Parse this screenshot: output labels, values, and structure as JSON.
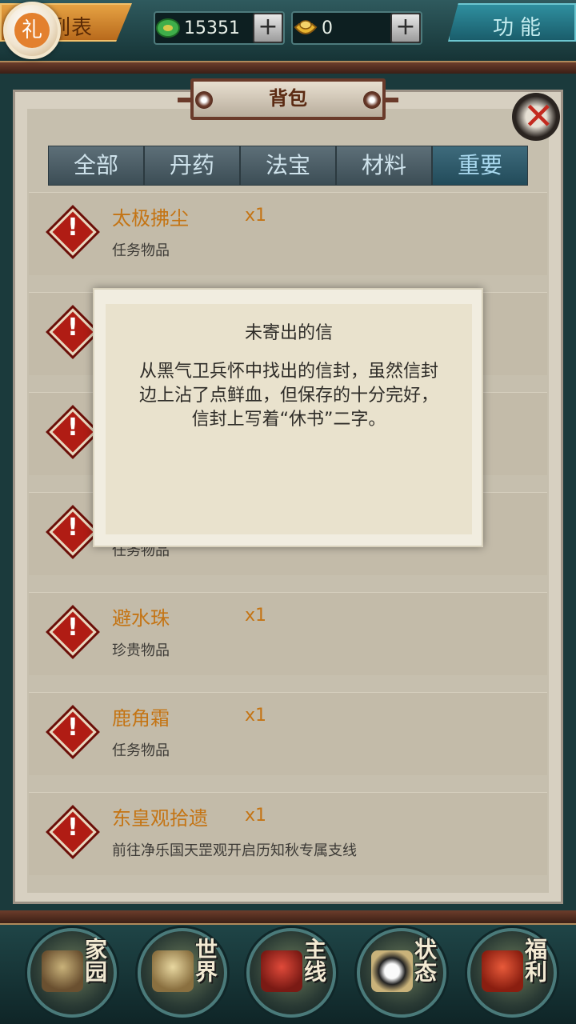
{
  "header": {
    "list_label": "列表",
    "gift_label": "礼",
    "jade_value": "15351",
    "gold_value": "0",
    "plus_label": "+",
    "function_label": "功能"
  },
  "panel": {
    "title": "背包",
    "close_label": "✕"
  },
  "tabs": [
    {
      "label": "全部"
    },
    {
      "label": "丹药"
    },
    {
      "label": "法宝"
    },
    {
      "label": "材料"
    },
    {
      "label": "重要"
    }
  ],
  "items": [
    {
      "name": "太极拂尘",
      "qty": "x1",
      "desc": "任务物品"
    },
    {
      "name": "",
      "qty": "",
      "desc": ""
    },
    {
      "name": "",
      "qty": "",
      "desc": ""
    },
    {
      "name": "",
      "qty": "",
      "desc": "任务物品"
    },
    {
      "name": "避水珠",
      "qty": "x1",
      "desc": "珍贵物品"
    },
    {
      "name": "鹿角霜",
      "qty": "x1",
      "desc": "任务物品"
    },
    {
      "name": "东皇观拾遗",
      "qty": "x1",
      "desc": "前往净乐国天罡观开启历知秋专属支线"
    }
  ],
  "popup": {
    "title": "未寄出的信",
    "line1": "从黑气卫兵怀中找出的信封，虽然信封",
    "line2": "边上沾了点鲜血，但保存的十分完好，",
    "line3": "信封上写着“休书”二字。"
  },
  "nav": [
    {
      "label": "家园"
    },
    {
      "label": "世界"
    },
    {
      "label": "主线"
    },
    {
      "label": "状态"
    },
    {
      "label": "福利"
    }
  ],
  "colors": {
    "item_name": "#c47414",
    "item_icon": "#b01c14",
    "active_tab": "#224b5a"
  }
}
